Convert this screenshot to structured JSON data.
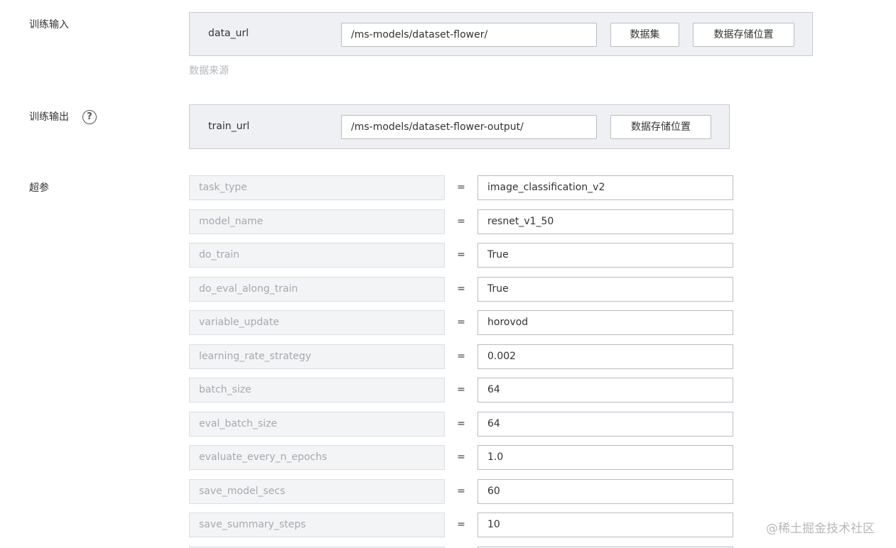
{
  "training_input": {
    "section_label": "训练输入",
    "param_name": "data_url",
    "path_value": "/ms-models/dataset-flower/",
    "dataset_button": "数据集",
    "storage_button": "数据存储位置",
    "hint": "数据来源"
  },
  "training_output": {
    "section_label": "训练输出",
    "help_icon": "question-circle-icon",
    "help_glyph": "?",
    "param_name": "train_url",
    "path_value": "/ms-models/dataset-flower-output/",
    "storage_button": "数据存储位置"
  },
  "hyperparameters": {
    "section_label": "超参",
    "equals_sign": "=",
    "rows": [
      {
        "key": "task_type",
        "value": "image_classification_v2"
      },
      {
        "key": "model_name",
        "value": "resnet_v1_50"
      },
      {
        "key": "do_train",
        "value": "True"
      },
      {
        "key": "do_eval_along_train",
        "value": "True"
      },
      {
        "key": "variable_update",
        "value": "horovod"
      },
      {
        "key": "learning_rate_strategy",
        "value": "0.002"
      },
      {
        "key": "batch_size",
        "value": "64"
      },
      {
        "key": "eval_batch_size",
        "value": "64"
      },
      {
        "key": "evaluate_every_n_epochs",
        "value": "1.0"
      },
      {
        "key": "save_model_secs",
        "value": "60"
      },
      {
        "key": "save_summary_steps",
        "value": "10"
      },
      {
        "key": "",
        "value": ""
      }
    ]
  },
  "watermark": "@稀土掘金技术社区"
}
